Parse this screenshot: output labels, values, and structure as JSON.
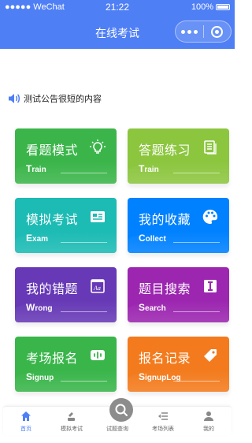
{
  "status_bar": {
    "carrier": "●●●●● WeChat",
    "time": "21:22",
    "battery": "100%"
  },
  "nav": {
    "title": "在线考试"
  },
  "notice": {
    "text": "测试公告很短的内容"
  },
  "cards": [
    {
      "title": "看题模式",
      "sub_big": "T",
      "sub_rest": "rain",
      "icon": "lightbulb-icon"
    },
    {
      "title": "答题练习",
      "sub_big": "T",
      "sub_rest": "rain",
      "icon": "document-icon"
    },
    {
      "title": "模拟考试",
      "sub_big": "E",
      "sub_rest": "xam",
      "icon": "id-card-icon"
    },
    {
      "title": "我的收藏",
      "sub_big": "C",
      "sub_rest": "ollect",
      "icon": "palette-icon"
    },
    {
      "title": "我的错题",
      "sub_big": "W",
      "sub_rest": "rong",
      "icon": "text-box-icon"
    },
    {
      "title": "题目搜索",
      "sub_big": "S",
      "sub_rest": "earch",
      "icon": "info-box-icon"
    },
    {
      "title": "考场报名",
      "sub_big": "S",
      "sub_rest": "ignup",
      "icon": "voice-message-icon"
    },
    {
      "title": "报名记录",
      "sub_big": "S",
      "sub_rest": "ignupLog",
      "icon": "tag-icon"
    }
  ],
  "tabbar": {
    "items": [
      {
        "label": "首页",
        "icon": "home-icon"
      },
      {
        "label": "模拟考试",
        "icon": "exam-icon"
      },
      {
        "label": "试题查询",
        "icon": "search-icon"
      },
      {
        "label": "考场列表",
        "icon": "list-icon"
      },
      {
        "label": "我的",
        "icon": "user-icon"
      }
    ]
  },
  "colors": {
    "primary": "#4f7ff5"
  }
}
